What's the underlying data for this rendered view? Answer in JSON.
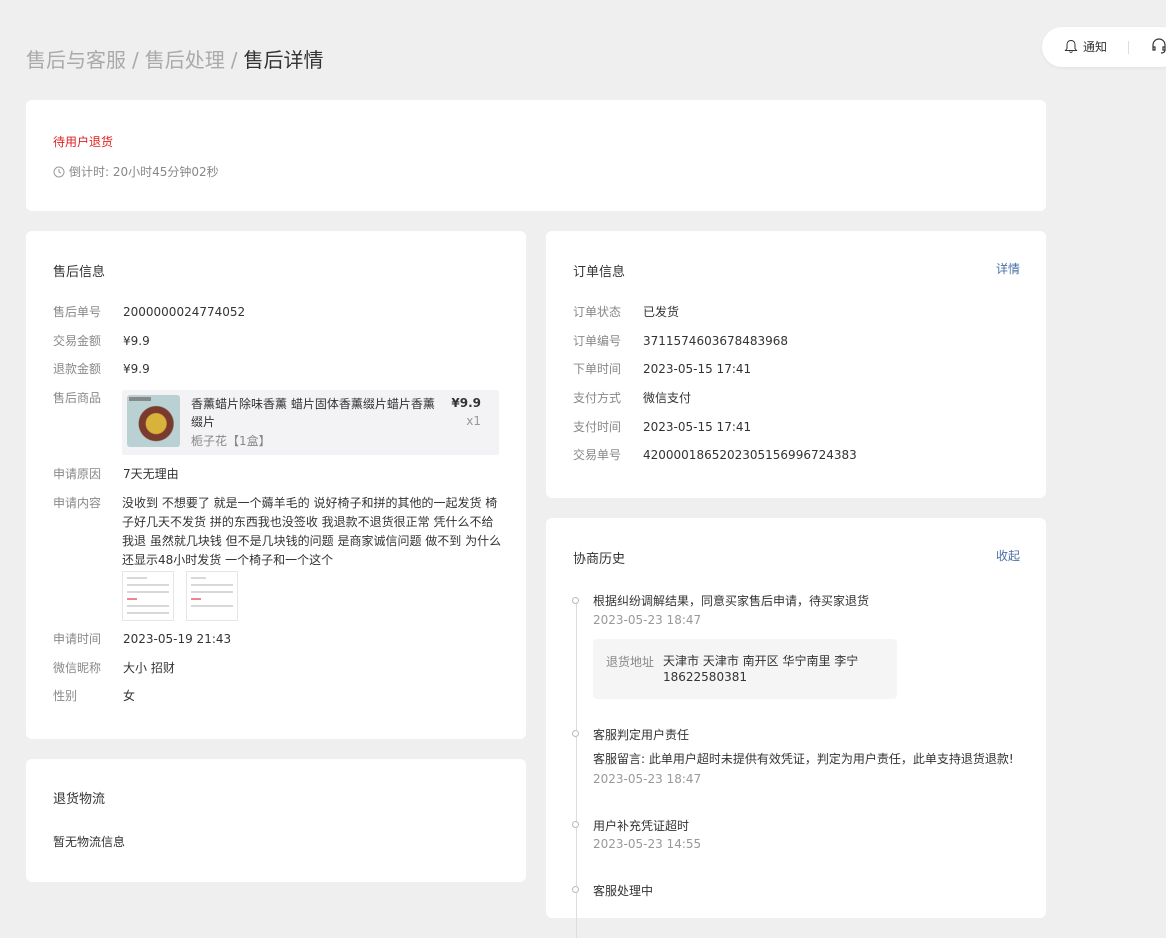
{
  "breadcrumb": {
    "item1": "售后与客服",
    "item2": "售后处理",
    "current": "售后详情",
    "separator": "/"
  },
  "topbar": {
    "notice_label": "通知"
  },
  "status": {
    "text": "待用户退货",
    "countdown": "倒计时: 20小时45分钟02秒"
  },
  "aftersale": {
    "title": "售后信息",
    "labels": {
      "id": "售后单号",
      "trade_amount": "交易金额",
      "refund_amount": "退款金额",
      "goods": "售后商品",
      "reason": "申请原因",
      "content": "申请内容",
      "time": "申请时间",
      "nickname": "微信昵称",
      "gender": "性别"
    },
    "values": {
      "id": "2000000024774052",
      "trade_amount": "¥9.9",
      "refund_amount": "¥9.9",
      "reason": "7天无理由",
      "content": "没收到 不想要了 就是一个薅羊毛的 说好椅子和拼的其他的一起发货 椅子好几天不发货 拼的东西我也没签收 我退款不退货很正常 凭什么不给我退 虽然就几块钱 但不是几块钱的问题 是商家诚信问题 做不到 为什么还显示48小时发货 一个椅子和一个这个",
      "time": "2023-05-19 21:43",
      "nickname": "大小 招财",
      "gender": "女"
    },
    "product": {
      "name": "香薰蜡片除味香薰 蜡片固体香薰缀片蜡片香薰 缀片",
      "spec": "栀子花【1盒】",
      "price": "¥9.9",
      "qty": "x1"
    }
  },
  "logistics": {
    "title": "退货物流",
    "empty": "暂无物流信息"
  },
  "order": {
    "title": "订单信息",
    "link": "详情",
    "rows": [
      {
        "label": "订单状态",
        "value": "已发货"
      },
      {
        "label": "订单编号",
        "value": "3711574603678483968"
      },
      {
        "label": "下单时间",
        "value": "2023-05-15 17:41"
      },
      {
        "label": "支付方式",
        "value": "微信支付"
      },
      {
        "label": "支付时间",
        "value": "2023-05-15 17:41"
      },
      {
        "label": "交易单号",
        "value": "4200001865202305156996724383"
      }
    ]
  },
  "history": {
    "title": "协商历史",
    "link": "收起",
    "events": [
      {
        "title": "根据纠纷调解结果，同意买家售后申请，待买家退货",
        "time": "2023-05-23 18:47",
        "address_label": "退货地址",
        "address": "天津市 天津市 南开区 华宁南里 李宁 18622580381"
      },
      {
        "title": "客服判定用户责任",
        "note": "客服留言: 此单用户超时未提供有效凭证，判定为用户责任，此单支持退货退款!",
        "time": "2023-05-23 18:47"
      },
      {
        "title": "用户补充凭证超时",
        "time": "2023-05-23 14:55"
      },
      {
        "title": "客服处理中"
      }
    ]
  },
  "colors": {
    "status_red": "#e02020",
    "link_blue": "#4a6fa5",
    "background": "#efefef"
  }
}
